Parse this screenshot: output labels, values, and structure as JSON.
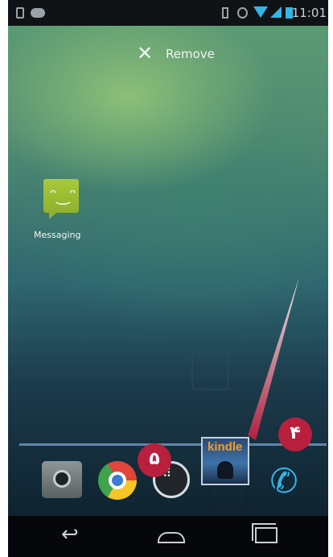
{
  "statusbar": {
    "time": "11:01",
    "icons": [
      "phone-icon",
      "game-controller-icon",
      "battery-small-icon",
      "sync-icon",
      "wifi-icon",
      "signal-icon",
      "battery-icon"
    ],
    "accent": "#33b5e5"
  },
  "drop_target": {
    "icon": "close-icon",
    "close_glyph": "✕",
    "label": "Remove"
  },
  "home_apps": [
    {
      "label": "Messaging",
      "icon": "messaging-icon",
      "glyph": "ᵔ‿ᵔ"
    }
  ],
  "dock": [
    {
      "icon": "camera-icon"
    },
    {
      "icon": "chrome-icon"
    },
    {
      "icon": "all-apps-icon",
      "glyph": "⠿"
    },
    {
      "icon": "phone-dialer-icon",
      "glyph": "✆"
    }
  ],
  "dragged_app": {
    "label": "kindle",
    "icon": "kindle-icon"
  },
  "annotations": [
    {
      "label": "۴",
      "color": "#b8203e"
    },
    {
      "label": "۵",
      "color": "#b8203e"
    }
  ],
  "navbar": {
    "back_glyph": "↩",
    "items": [
      "back-icon",
      "home-icon",
      "recent-apps-icon"
    ]
  }
}
